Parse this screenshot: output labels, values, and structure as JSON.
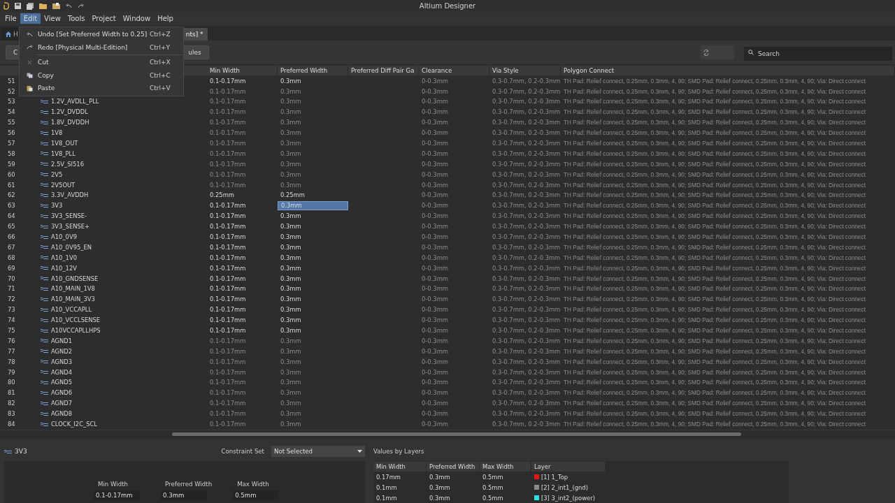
{
  "window": {
    "title": "Altium Designer"
  },
  "menu_bar": [
    {
      "label": "File",
      "selected": false
    },
    {
      "label": "Edit",
      "selected": true
    },
    {
      "label": "View",
      "selected": false
    },
    {
      "label": "Tools",
      "selected": false
    },
    {
      "label": "Project",
      "selected": false
    },
    {
      "label": "Window",
      "selected": false
    },
    {
      "label": "Help",
      "selected": false
    }
  ],
  "edit_menu": [
    {
      "kind": "undo",
      "label": "Undo [Set Preferred Width to 0.25]",
      "shortcut": "Ctrl+Z"
    },
    {
      "kind": "redo",
      "label": "Redo [Physical Multi-Edition]",
      "shortcut": "Ctrl+Y"
    },
    {
      "kind": "separator"
    },
    {
      "kind": "cut",
      "label": "Cut",
      "shortcut": "Ctrl+X"
    },
    {
      "kind": "copy",
      "label": "Copy",
      "shortcut": "Ctrl+C"
    },
    {
      "kind": "paste",
      "label": "Paste",
      "shortcut": "Ctrl+V"
    }
  ],
  "document_tabs": [
    {
      "kind": "home",
      "label": "H",
      "selected": false
    },
    {
      "kind": "doc",
      "label": "nts] *",
      "selected": true
    }
  ],
  "toolbar": {
    "buttons": [
      "C",
      "ules"
    ],
    "search": {
      "placeholder": "Search"
    }
  },
  "table": {
    "columns": [
      "Min Width",
      "Preferred Width",
      "Preferred Diff Pair Ga",
      "Clearance",
      "Via Style",
      "Polygon Connect"
    ],
    "rows": [
      {
        "num": "51",
        "dimmed": false,
        "min_width": "0.1-0.17mm",
        "preferred_width": "0.3mm",
        "clearance": "0-0.3mm",
        "via_style": "0.3-0.7mm, 0.2-0.3mm",
        "polygon": "TH Pad: Relief connect, 0.25mm, 0.3mm, 4, 90; SMD Pad: Relief connect, 0.25mm, 0.3mm, 4, 90; Via: Direct connect",
        "selected": false
      },
      {
        "num": "52",
        "dimmed": true,
        "min_width": "0.1-0.17mm",
        "preferred_width": "0.3mm",
        "clearance": "0-0.3mm",
        "via_style": "0.3-0.7mm, 0.2-0.3mm",
        "polygon": "TH Pad: Relief connect, 0.25mm, 0.3mm, 4, 90; SMD Pad: Relief connect, 0.25mm, 0.3mm, 4, 90; Via: Direct connect",
        "selected": false
      },
      {
        "num": "53",
        "name": "1.2V_AVDLL_PLL",
        "dimmed": true,
        "min_width": "0.1-0.17mm",
        "preferred_width": "0.3mm",
        "clearance": "0-0.3mm",
        "via_style": "0.3-0.7mm, 0.2-0.3mm",
        "polygon": "TH Pad: Relief connect, 0.25mm, 0.3mm, 4, 90; SMD Pad: Relief connect, 0.25mm, 0.3mm, 4, 90; Via: Direct connect",
        "selected": false
      },
      {
        "num": "54",
        "name": "1.2V_DVDDL",
        "dimmed": true,
        "min_width": "0.1-0.17mm",
        "preferred_width": "0.3mm",
        "clearance": "0-0.3mm",
        "via_style": "0.3-0.7mm, 0.2-0.3mm",
        "polygon": "TH Pad: Relief connect, 0.25mm, 0.3mm, 4, 90; SMD Pad: Relief connect, 0.25mm, 0.3mm, 4, 90; Via: Direct connect",
        "selected": false
      },
      {
        "num": "55",
        "name": "1.8V_DVDDH",
        "dimmed": true,
        "min_width": "0.1-0.17mm",
        "preferred_width": "0.3mm",
        "clearance": "0-0.3mm",
        "via_style": "0.3-0.7mm, 0.2-0.3mm",
        "polygon": "TH Pad: Relief connect, 0.25mm, 0.3mm, 4, 90; SMD Pad: Relief connect, 0.25mm, 0.3mm, 4, 90; Via: Direct connect",
        "selected": false
      },
      {
        "num": "56",
        "name": "1V8",
        "dimmed": true,
        "min_width": "0.1-0.17mm",
        "preferred_width": "0.3mm",
        "clearance": "0-0.3mm",
        "via_style": "0.3-0.7mm, 0.2-0.3mm",
        "polygon": "TH Pad: Relief connect, 0.25mm, 0.3mm, 4, 90; SMD Pad: Relief connect, 0.25mm, 0.3mm, 4, 90; Via: Direct connect",
        "selected": false
      },
      {
        "num": "57",
        "name": "1V8_OUT",
        "dimmed": true,
        "min_width": "0.1-0.17mm",
        "preferred_width": "0.3mm",
        "clearance": "0-0.3mm",
        "via_style": "0.3-0.7mm, 0.2-0.3mm",
        "polygon": "TH Pad: Relief connect, 0.25mm, 0.3mm, 4, 90; SMD Pad: Relief connect, 0.25mm, 0.3mm, 4, 90; Via: Direct connect",
        "selected": false
      },
      {
        "num": "58",
        "name": "1V8_PLL",
        "dimmed": true,
        "min_width": "0.1-0.17mm",
        "preferred_width": "0.3mm",
        "clearance": "0-0.3mm",
        "via_style": "0.3-0.7mm, 0.2-0.3mm",
        "polygon": "TH Pad: Relief connect, 0.25mm, 0.3mm, 4, 90; SMD Pad: Relief connect, 0.25mm, 0.3mm, 4, 90; Via: Direct connect",
        "selected": false
      },
      {
        "num": "59",
        "name": "2.5V_SI516",
        "dimmed": true,
        "min_width": "0.1-0.17mm",
        "preferred_width": "0.3mm",
        "clearance": "0-0.3mm",
        "via_style": "0.3-0.7mm, 0.2-0.3mm",
        "polygon": "TH Pad: Relief connect, 0.25mm, 0.3mm, 4, 90; SMD Pad: Relief connect, 0.25mm, 0.3mm, 4, 90; Via: Direct connect",
        "selected": false
      },
      {
        "num": "60",
        "name": "2V5",
        "dimmed": true,
        "min_width": "0.1-0.17mm",
        "preferred_width": "0.3mm",
        "clearance": "0-0.3mm",
        "via_style": "0.3-0.7mm, 0.2-0.3mm",
        "polygon": "TH Pad: Relief connect, 0.25mm, 0.3mm, 4, 90; SMD Pad: Relief connect, 0.25mm, 0.3mm, 4, 90; Via: Direct connect",
        "selected": false
      },
      {
        "num": "61",
        "name": "2V5OUT",
        "dimmed": true,
        "min_width": "0.1-0.17mm",
        "preferred_width": "0.3mm",
        "clearance": "0-0.3mm",
        "via_style": "0.3-0.7mm, 0.2-0.3mm",
        "polygon": "TH Pad: Relief connect, 0.25mm, 0.3mm, 4, 90; SMD Pad: Relief connect, 0.25mm, 0.3mm, 4, 90; Via: Direct connect",
        "selected": false
      },
      {
        "num": "62",
        "name": "3.3V_AVDDH",
        "dimmed": false,
        "min_width": "0.25mm",
        "preferred_width": "0.25mm",
        "clearance": "0-0.3mm",
        "via_style": "0.3-0.7mm, 0.2-0.3mm",
        "polygon": "TH Pad: Relief connect, 0.25mm, 0.3mm, 4, 90; SMD Pad: Relief connect, 0.25mm, 0.3mm, 4, 90; Via: Direct connect",
        "selected": false
      },
      {
        "num": "63",
        "name": "3V3",
        "dimmed": false,
        "min_width": "0.1-0.17mm",
        "preferred_width": "0.3mm",
        "clearance": "0-0.3mm",
        "via_style": "0.3-0.7mm, 0.2-0.3mm",
        "polygon": "TH Pad: Relief connect, 0.25mm, 0.3mm, 4, 90; SMD Pad: Relief connect, 0.25mm, 0.3mm, 4, 90; Via: Direct connect",
        "selected": true
      },
      {
        "num": "64",
        "name": "3V3_SENSE-",
        "dimmed": false,
        "min_width": "0.1-0.17mm",
        "preferred_width": "0.3mm",
        "clearance": "0-0.3mm",
        "via_style": "0.3-0.7mm, 0.2-0.3mm",
        "polygon": "TH Pad: Relief connect, 0.25mm, 0.3mm, 4, 90; SMD Pad: Relief connect, 0.25mm, 0.3mm, 4, 90; Via: Direct connect",
        "selected": false
      },
      {
        "num": "65",
        "name": "3V3_SENSE+",
        "dimmed": false,
        "min_width": "0.1-0.17mm",
        "preferred_width": "0.3mm",
        "clearance": "0-0.3mm",
        "via_style": "0.3-0.7mm, 0.2-0.3mm",
        "polygon": "TH Pad: Relief connect, 0.25mm, 0.3mm, 4, 90; SMD Pad: Relief connect, 0.25mm, 0.3mm, 4, 90; Via: Direct connect",
        "selected": false
      },
      {
        "num": "66",
        "name": "A10_0V9",
        "dimmed": false,
        "min_width": "0.1-0.17mm",
        "preferred_width": "0.3mm",
        "clearance": "0-0.3mm",
        "via_style": "0.3-0.7mm, 0.2-0.3mm",
        "polygon": "TH Pad: Relief connect, 0.25mm, 0.3mm, 4, 90; SMD Pad: Relief connect, 0.25mm, 0.3mm, 4, 90; Via: Direct connect",
        "selected": false
      },
      {
        "num": "67",
        "name": "A10_0V95_EN",
        "dimmed": false,
        "min_width": "0.1-0.17mm",
        "preferred_width": "0.3mm",
        "clearance": "0-0.3mm",
        "via_style": "0.3-0.7mm, 0.2-0.3mm",
        "polygon": "TH Pad: Relief connect, 0.25mm, 0.3mm, 4, 90; SMD Pad: Relief connect, 0.25mm, 0.3mm, 4, 90; Via: Direct connect",
        "selected": false
      },
      {
        "num": "68",
        "name": "A10_1V0",
        "dimmed": false,
        "min_width": "0.1-0.17mm",
        "preferred_width": "0.3mm",
        "clearance": "0-0.3mm",
        "via_style": "0.3-0.7mm, 0.2-0.3mm",
        "polygon": "TH Pad: Relief connect, 0.25mm, 0.3mm, 4, 90; SMD Pad: Relief connect, 0.25mm, 0.3mm, 4, 90; Via: Direct connect",
        "selected": false
      },
      {
        "num": "69",
        "name": "A10_12V",
        "dimmed": false,
        "min_width": "0.1-0.17mm",
        "preferred_width": "0.3mm",
        "clearance": "0-0.3mm",
        "via_style": "0.3-0.7mm, 0.2-0.3mm",
        "polygon": "TH Pad: Relief connect, 0.25mm, 0.3mm, 4, 90; SMD Pad: Relief connect, 0.25mm, 0.3mm, 4, 90; Via: Direct connect",
        "selected": false
      },
      {
        "num": "70",
        "name": "A10_GNDSENSE",
        "dimmed": false,
        "min_width": "0.1-0.17mm",
        "preferred_width": "0.3mm",
        "clearance": "0-0.3mm",
        "via_style": "0.3-0.7mm, 0.2-0.3mm",
        "polygon": "TH Pad: Relief connect, 0.25mm, 0.3mm, 4, 90; SMD Pad: Relief connect, 0.25mm, 0.3mm, 4, 90; Via: Direct connect",
        "selected": false
      },
      {
        "num": "71",
        "name": "A10_MAIN_1V8",
        "dimmed": false,
        "min_width": "0.1-0.17mm",
        "preferred_width": "0.3mm",
        "clearance": "0-0.3mm",
        "via_style": "0.3-0.7mm, 0.2-0.3mm",
        "polygon": "TH Pad: Relief connect, 0.25mm, 0.3mm, 4, 90; SMD Pad: Relief connect, 0.25mm, 0.3mm, 4, 90; Via: Direct connect",
        "selected": false
      },
      {
        "num": "72",
        "name": "A10_MAIN_3V3",
        "dimmed": false,
        "min_width": "0.1-0.17mm",
        "preferred_width": "0.3mm",
        "clearance": "0-0.3mm",
        "via_style": "0.3-0.7mm, 0.2-0.3mm",
        "polygon": "TH Pad: Relief connect, 0.25mm, 0.3mm, 4, 90; SMD Pad: Relief connect, 0.25mm, 0.3mm, 4, 90; Via: Direct connect",
        "selected": false
      },
      {
        "num": "73",
        "name": "A10_VCCAPLL",
        "dimmed": false,
        "min_width": "0.1-0.17mm",
        "preferred_width": "0.3mm",
        "clearance": "0-0.3mm",
        "via_style": "0.3-0.7mm, 0.2-0.3mm",
        "polygon": "TH Pad: Relief connect, 0.25mm, 0.3mm, 4, 90; SMD Pad: Relief connect, 0.25mm, 0.3mm, 4, 90; Via: Direct connect",
        "selected": false
      },
      {
        "num": "74",
        "name": "A10_VCCLSENSE",
        "dimmed": false,
        "min_width": "0.1-0.17mm",
        "preferred_width": "0.3mm",
        "clearance": "0-0.3mm",
        "via_style": "0.3-0.7mm, 0.2-0.3mm",
        "polygon": "TH Pad: Relief connect, 0.25mm, 0.3mm, 4, 90; SMD Pad: Relief connect, 0.25mm, 0.3mm, 4, 90; Via: Direct connect",
        "selected": false
      },
      {
        "num": "75",
        "name": "A10VCCAPLLHPS",
        "dimmed": false,
        "min_width": "0.1-0.17mm",
        "preferred_width": "0.3mm",
        "clearance": "0-0.3mm",
        "via_style": "0.3-0.7mm, 0.2-0.3mm",
        "polygon": "TH Pad: Relief connect, 0.25mm, 0.3mm, 4, 90; SMD Pad: Relief connect, 0.25mm, 0.3mm, 4, 90; Via: Direct connect",
        "selected": false
      },
      {
        "num": "76",
        "name": "AGND1",
        "dimmed": true,
        "min_width": "0.1-0.17mm",
        "preferred_width": "0.3mm",
        "clearance": "0-0.3mm",
        "via_style": "0.3-0.7mm, 0.2-0.3mm",
        "polygon": "TH Pad: Relief connect, 0.25mm, 0.3mm, 4, 90; SMD Pad: Relief connect, 0.25mm, 0.3mm, 4, 90; Via: Direct connect",
        "selected": false
      },
      {
        "num": "77",
        "name": "AGND2",
        "dimmed": true,
        "min_width": "0.1-0.17mm",
        "preferred_width": "0.3mm",
        "clearance": "0-0.3mm",
        "via_style": "0.3-0.7mm, 0.2-0.3mm",
        "polygon": "TH Pad: Relief connect, 0.25mm, 0.3mm, 4, 90; SMD Pad: Relief connect, 0.25mm, 0.3mm, 4, 90; Via: Direct connect",
        "selected": false
      },
      {
        "num": "78",
        "name": "AGND3",
        "dimmed": true,
        "min_width": "0.1-0.17mm",
        "preferred_width": "0.3mm",
        "clearance": "0-0.3mm",
        "via_style": "0.3-0.7mm, 0.2-0.3mm",
        "polygon": "TH Pad: Relief connect, 0.25mm, 0.3mm, 4, 90; SMD Pad: Relief connect, 0.25mm, 0.3mm, 4, 90; Via: Direct connect",
        "selected": false
      },
      {
        "num": "79",
        "name": "AGND4",
        "dimmed": true,
        "min_width": "0.1-0.17mm",
        "preferred_width": "0.3mm",
        "clearance": "0-0.3mm",
        "via_style": "0.3-0.7mm, 0.2-0.3mm",
        "polygon": "TH Pad: Relief connect, 0.25mm, 0.3mm, 4, 90; SMD Pad: Relief connect, 0.25mm, 0.3mm, 4, 90; Via: Direct connect",
        "selected": false
      },
      {
        "num": "80",
        "name": "AGND5",
        "dimmed": true,
        "min_width": "0.1-0.17mm",
        "preferred_width": "0.3mm",
        "clearance": "0-0.3mm",
        "via_style": "0.3-0.7mm, 0.2-0.3mm",
        "polygon": "TH Pad: Relief connect, 0.25mm, 0.3mm, 4, 90; SMD Pad: Relief connect, 0.25mm, 0.3mm, 4, 90; Via: Direct connect",
        "selected": false
      },
      {
        "num": "81",
        "name": "AGND6",
        "dimmed": true,
        "min_width": "0.1-0.17mm",
        "preferred_width": "0.3mm",
        "clearance": "0-0.3mm",
        "via_style": "0.3-0.7mm, 0.2-0.3mm",
        "polygon": "TH Pad: Relief connect, 0.25mm, 0.3mm, 4, 90; SMD Pad: Relief connect, 0.25mm, 0.3mm, 4, 90; Via: Direct connect",
        "selected": false
      },
      {
        "num": "82",
        "name": "AGND7",
        "dimmed": true,
        "min_width": "0.1-0.17mm",
        "preferred_width": "0.3mm",
        "clearance": "0-0.3mm",
        "via_style": "0.3-0.7mm, 0.2-0.3mm",
        "polygon": "TH Pad: Relief connect, 0.25mm, 0.3mm, 4, 90; SMD Pad: Relief connect, 0.25mm, 0.3mm, 4, 90; Via: Direct connect",
        "selected": false
      },
      {
        "num": "83",
        "name": "AGND8",
        "dimmed": true,
        "min_width": "0.1-0.17mm",
        "preferred_width": "0.3mm",
        "clearance": "0-0.3mm",
        "via_style": "0.3-0.7mm, 0.2-0.3mm",
        "polygon": "TH Pad: Relief connect, 0.25mm, 0.3mm, 4, 90; SMD Pad: Relief connect, 0.25mm, 0.3mm, 4, 90; Via: Direct connect",
        "selected": false
      },
      {
        "num": "84",
        "name": "CLOCK_I2C_SCL",
        "dimmed": true,
        "min_width": "0.1-0.17mm",
        "preferred_width": "0.3mm",
        "clearance": "0-0.3mm",
        "via_style": "0.3-0.7mm, 0.2-0.3mm",
        "polygon": "TH Pad: Relief connect, 0.25mm, 0.3mm, 4, 90; SMD Pad: Relief connect, 0.25mm, 0.3mm, 4, 90; Via: Direct connect",
        "selected": false
      }
    ]
  },
  "details": {
    "net": "3V3",
    "constraint_set_label": "Constraint Set",
    "constraint_set": "Not Selected",
    "fields": [
      {
        "label": "Min Width",
        "value": "0.1-0.17mm"
      },
      {
        "label": "Preferred Width",
        "value": "0.3mm"
      },
      {
        "label": "Max Width",
        "value": "0.5mm"
      }
    ],
    "values_by_layers": {
      "title": "Values by Layers",
      "columns": [
        "Min Width",
        "Preferred Width",
        "Max Width",
        "Layer"
      ],
      "rows": [
        {
          "min": "0.17mm",
          "preferred": "0.3mm",
          "max": "0.5mm",
          "layer": "[1] 1_Top",
          "color": "#e01818"
        },
        {
          "min": "0.1mm",
          "preferred": "0.3mm",
          "max": "0.5mm",
          "layer": "[2] 2_int1_(gnd)",
          "color": "#8a8a8a"
        },
        {
          "min": "0.1mm",
          "preferred": "0.3mm",
          "max": "0.5mm",
          "layer": "[3] 3_int2_(power)",
          "color": "#30e0e0"
        }
      ]
    }
  }
}
